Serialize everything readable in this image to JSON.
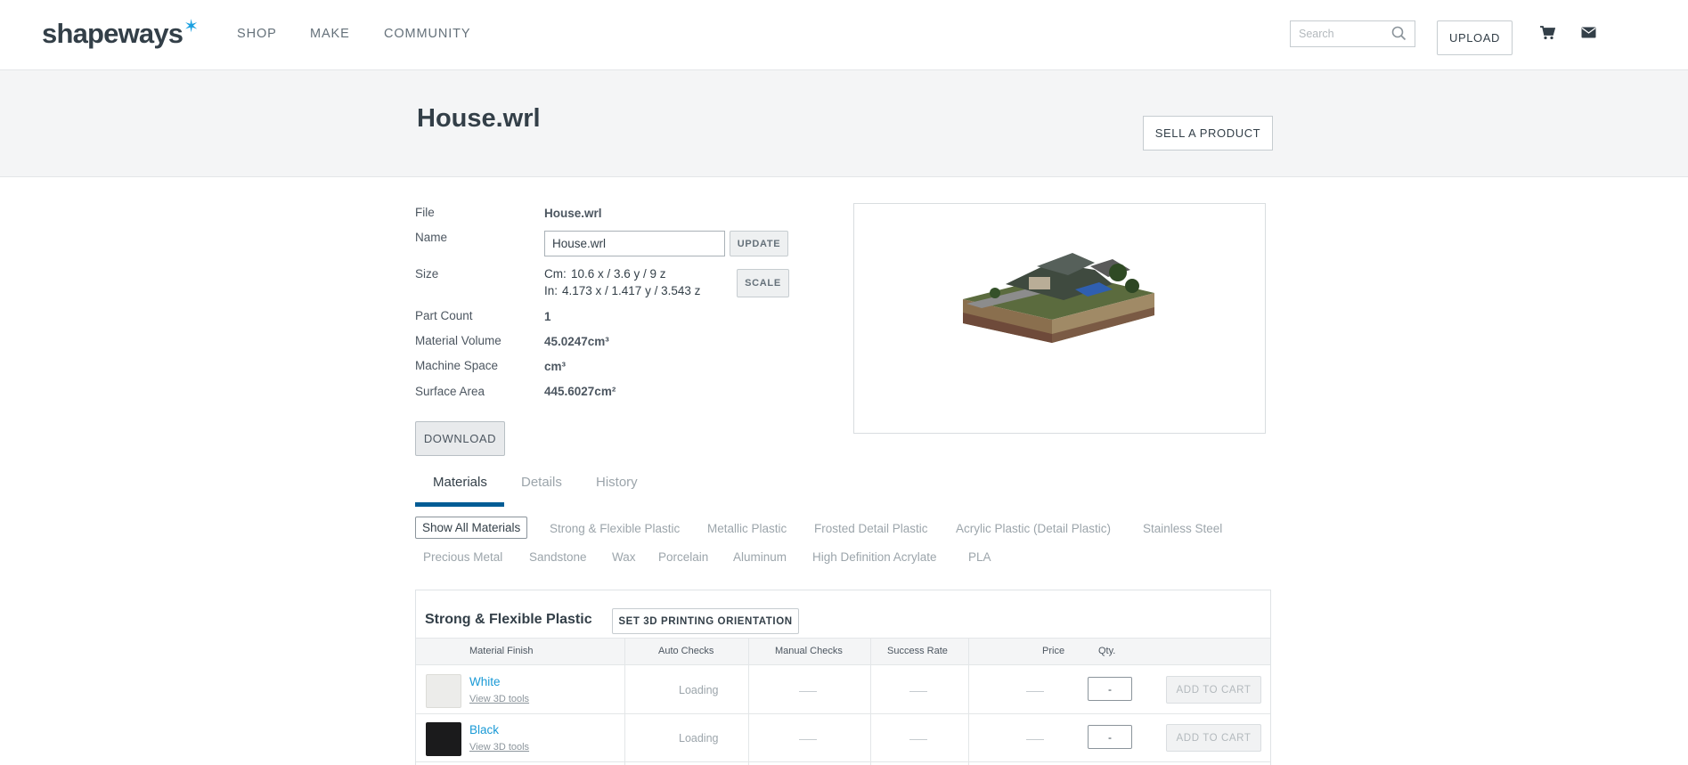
{
  "header": {
    "logo": "shapeways",
    "logo_star": "✶",
    "nav": [
      "SHOP",
      "MAKE",
      "COMMUNITY"
    ],
    "search_placeholder": "Search",
    "upload_label": "UPLOAD",
    "icons": [
      "search-icon",
      "cart-icon",
      "mail-icon"
    ]
  },
  "page": {
    "title": "House.wrl",
    "sell_label": "SELL A PRODUCT"
  },
  "file_info": {
    "file_label": "File",
    "file_value": "House.wrl",
    "name_label": "Name",
    "name_value": "House.wrl",
    "update_label": "UPDATE",
    "size_label": "Size",
    "size_cm_prefix": "Cm:",
    "size_cm": "10.6 x / 3.6 y / 9 z",
    "size_in_prefix": "In:",
    "size_in": "4.173 x / 1.417 y / 3.543 z",
    "scale_label": "SCALE",
    "part_count_label": "Part Count",
    "part_count": "1",
    "material_volume_label": "Material Volume",
    "material_volume": "45.0247cm³",
    "machine_space_label": "Machine Space",
    "machine_space": "cm³",
    "surface_area_label": "Surface Area",
    "surface_area": "445.6027cm²",
    "download_label": "DOWNLOAD"
  },
  "tabs": [
    "Materials",
    "Details",
    "History"
  ],
  "filters": {
    "active": "Show All Materials",
    "row1": [
      "Strong & Flexible Plastic",
      "Metallic Plastic",
      "Frosted Detail Plastic",
      "Acrylic Plastic (Detail Plastic)",
      "Stainless Steel"
    ],
    "row2": [
      "Precious Metal",
      "Sandstone",
      "Wax",
      "Porcelain",
      "Aluminum",
      "High Definition Acrylate",
      "PLA"
    ]
  },
  "materials": {
    "title": "Strong & Flexible Plastic",
    "orientation_label": "SET 3D PRINTING ORIENTATION",
    "columns": [
      "Material Finish",
      "Auto Checks",
      "Manual Checks",
      "Success Rate",
      "Price",
      "Qty."
    ],
    "rows": [
      {
        "name": "White",
        "tools": "View 3D tools",
        "status": "Loading",
        "qty": "-",
        "cart": "ADD TO CART",
        "swatch": "#ececea"
      },
      {
        "name": "Black",
        "tools": "View 3D tools",
        "status": "Loading",
        "qty": "-",
        "cart": "ADD TO CART",
        "swatch": "#1b1b1c"
      }
    ]
  },
  "colors": {
    "accent": "#015c95",
    "link": "#1a9ad6",
    "logo_star": "#1aa0e0",
    "text": "#333f48"
  }
}
